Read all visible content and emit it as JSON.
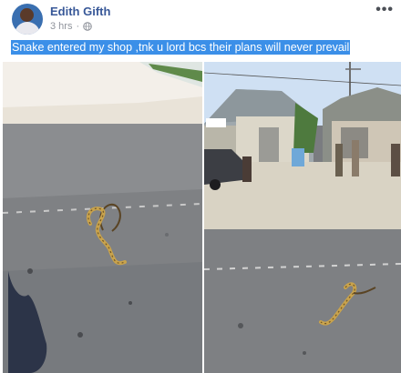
{
  "post": {
    "author": "Edith Gifth",
    "time": "3 hrs",
    "separator": "·",
    "privacy_icon": "globe-icon",
    "more_icon": "more-options-icon",
    "more_label": "•••",
    "caption": "Snake entered my shop ,tnk u lord bcs their plans will never prevail"
  },
  "colors": {
    "author_link": "#385898",
    "caption_highlight": "#3b8fe8",
    "meta_text": "#90949c"
  }
}
